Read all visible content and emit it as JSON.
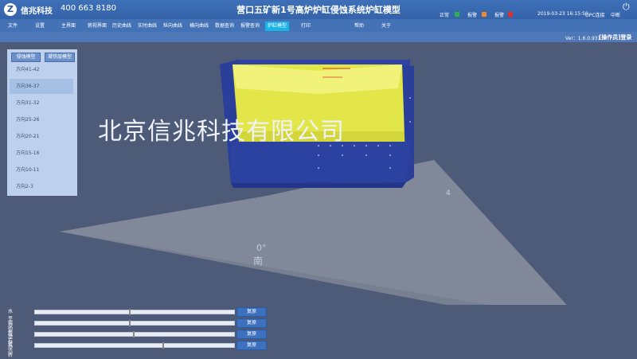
{
  "header": {
    "logo_letter": "Z",
    "company": "信兆科技",
    "phone": "400 663 8180",
    "title": "营口五矿新1号高炉炉缸侵蚀系统炉缸模型",
    "status": {
      "normal_label": "正常",
      "warning_label": "报警",
      "alarm_label": "报警",
      "datetime": "2019-03-23 16:15:50",
      "opc_status": "OPC连接",
      "run_status": "中断",
      "colors": {
        "normal": "#2bb24c",
        "warning": "#f08a24",
        "alarm": "#e0302c"
      }
    },
    "power_icon": "power-icon"
  },
  "menu": {
    "items": [
      "文件",
      "设置",
      "主界面",
      "俯视界面",
      "历史曲线",
      "实时曲线",
      "纵向曲线",
      "横向曲线",
      "数据查询",
      "报警查询",
      "炉缸模型",
      "打印",
      "帮助",
      "关于"
    ],
    "active": "炉缸模型"
  },
  "info": {
    "version": "Ver：1.6.0.931",
    "operator": "[操作员]登录"
  },
  "panel": {
    "buttons": [
      "侵蚀模型",
      "凝铁层模型"
    ],
    "items": [
      "方向41-42",
      "方向36-37",
      "方向31-32",
      "方向25-26",
      "方向20-21",
      "方向15-16",
      "方向10-11",
      "方向2-3"
    ],
    "selected_index": 1
  },
  "scene": {
    "watermark": "北京信兆科技有限公司",
    "angle_0": "0°",
    "direction_0": "南",
    "angle_right": "4"
  },
  "controls": [
    {
      "label": "水平旋转",
      "button": "复原",
      "position": 0.47
    },
    {
      "label": "俯仰旋转",
      "button": "复原",
      "position": 0.47
    },
    {
      "label": "左右旋转",
      "button": "复原",
      "position": 0.49
    },
    {
      "label": "大小",
      "button": "复原",
      "position": 0.64
    }
  ]
}
